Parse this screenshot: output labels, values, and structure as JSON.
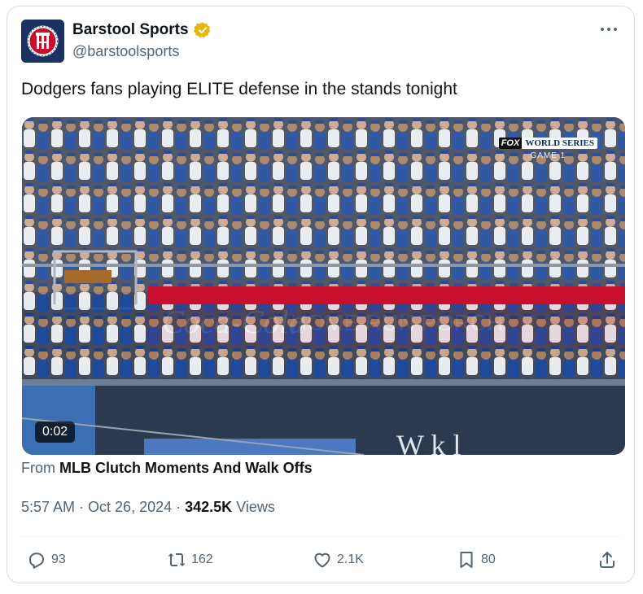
{
  "author": {
    "display_name": "Barstool Sports",
    "handle": "@barstoolsports",
    "avatar_icon": "barstool-logo",
    "verified_color": "#e8b600"
  },
  "tweet": {
    "text": "Dodgers fans playing ELITE defense in the stands tonight"
  },
  "media": {
    "timestamp": "0:02",
    "broadcast_network": "FOX",
    "broadcast_title": "WORLD SERIES",
    "broadcast_game": "GAME 1"
  },
  "source": {
    "prefix": "From",
    "name": "MLB Clutch Moments And Walk Offs"
  },
  "meta": {
    "time": "5:57 AM",
    "date": "Oct 26, 2024",
    "views_count": "342.5K",
    "views_label": "Views"
  },
  "actions": {
    "replies": "93",
    "reposts": "162",
    "likes": "2.1K",
    "bookmarks": "80"
  },
  "icons": {
    "reply": "reply-icon",
    "repost": "repost-icon",
    "like": "heart-icon",
    "bookmark": "bookmark-icon",
    "share": "share-icon",
    "more": "more-icon"
  }
}
